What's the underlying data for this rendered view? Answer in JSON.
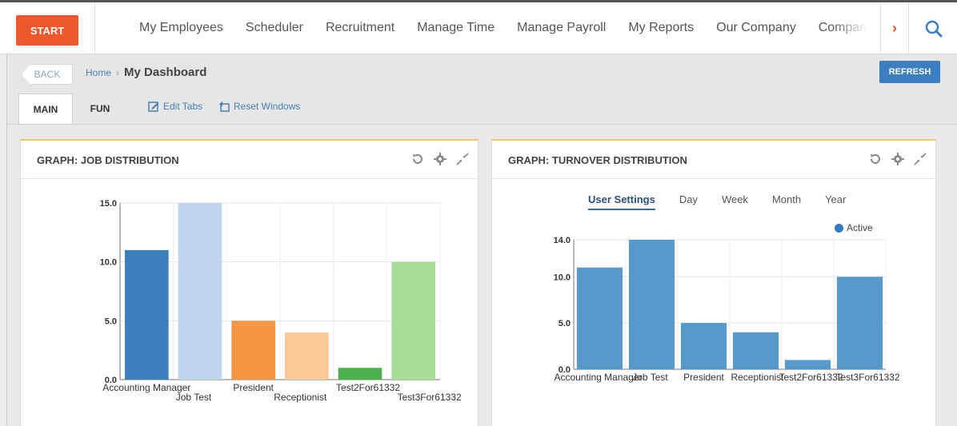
{
  "topbar": {
    "start_label": "START",
    "nav_items": [
      "My Employees",
      "Scheduler",
      "Recruitment",
      "Manage Time",
      "Manage Payroll",
      "My Reports",
      "Our Company",
      "Company Sett"
    ],
    "next_arrow": "›"
  },
  "subheader": {
    "back_label": "BACK",
    "breadcrumb_home": "Home",
    "breadcrumb_sep": "›",
    "breadcrumb_current": "My Dashboard",
    "refresh_label": "REFRESH",
    "tabs": [
      "MAIN",
      "FUN"
    ],
    "edit_tabs_label": "Edit Tabs",
    "reset_windows_label": "Reset Windows"
  },
  "panels": {
    "left_title": "GRAPH: JOB DISTRIBUTION",
    "right_title": "GRAPH: TURNOVER DISTRIBUTION",
    "period_tabs": [
      "User Settings",
      "Day",
      "Week",
      "Month",
      "Year"
    ],
    "legend_label": "Active"
  },
  "colors": {
    "accent": "#f0572a",
    "refresh": "#3c7fc1",
    "panel_border": "#f6c75e"
  },
  "chart_data": [
    {
      "type": "bar",
      "categories": [
        "Accounting Manager",
        "Job Test",
        "President",
        "Receptionist",
        "Test2For61332",
        "Test3For61332"
      ],
      "values": [
        11,
        15,
        5,
        4,
        1,
        10
      ],
      "colors": [
        "#3b7fbd",
        "#c0d4ec",
        "#f59642",
        "#fbc896",
        "#4cae4c",
        "#a8dd98"
      ],
      "ylim": [
        0,
        15
      ],
      "yticks": [
        "0.0",
        "5.0",
        "10.0",
        "15.0"
      ],
      "grid": true
    },
    {
      "type": "bar",
      "categories": [
        "Accounting Manager",
        "Job Test",
        "President",
        "Receptionist",
        "Test2For61332",
        "Test3For61332"
      ],
      "series": [
        {
          "name": "Active",
          "values": [
            11,
            14,
            5,
            4,
            1,
            10
          ]
        }
      ],
      "color": "#4f93c8",
      "ylim": [
        0,
        14
      ],
      "yticks": [
        "0.0",
        "5.0",
        "10.0",
        "14.0"
      ],
      "legend": "top-right",
      "grid": true
    }
  ]
}
